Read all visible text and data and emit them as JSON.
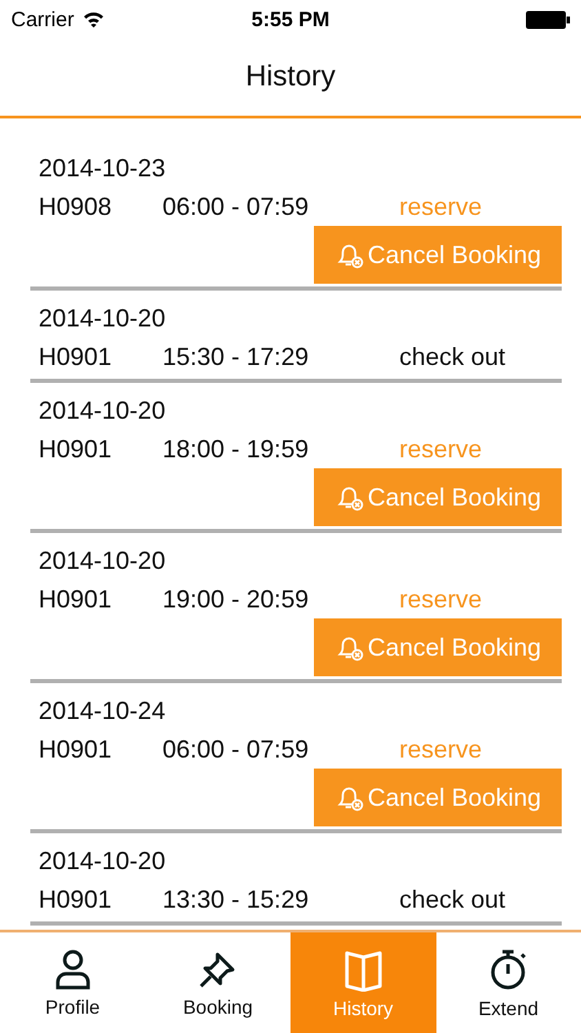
{
  "status_bar": {
    "carrier": "Carrier",
    "time": "5:55 PM"
  },
  "header": {
    "title": "History"
  },
  "bookings": [
    {
      "date": "2014-10-23",
      "room": "H0908",
      "time": "06:00 - 07:59",
      "status": "reserve",
      "kind": "reserve",
      "action": "Cancel Booking"
    },
    {
      "date": "2014-10-20",
      "room": "H0901",
      "time": "15:30 - 17:29",
      "status": "check out",
      "kind": "checkout"
    },
    {
      "date": "2014-10-20",
      "room": "H0901",
      "time": "18:00 - 19:59",
      "status": "reserve",
      "kind": "reserve",
      "action": "Cancel Booking"
    },
    {
      "date": "2014-10-20",
      "room": "H0901",
      "time": "19:00 - 20:59",
      "status": "reserve",
      "kind": "reserve",
      "action": "Cancel Booking"
    },
    {
      "date": "2014-10-24",
      "room": "H0901",
      "time": "06:00 - 07:59",
      "status": "reserve",
      "kind": "reserve",
      "action": "Cancel Booking"
    },
    {
      "date": "2014-10-20",
      "room": "H0901",
      "time": "13:30 - 15:29",
      "status": "check out",
      "kind": "checkout"
    }
  ],
  "tabs": [
    {
      "label": "Profile",
      "selected": false
    },
    {
      "label": "Booking",
      "selected": false
    },
    {
      "label": "History",
      "selected": true
    },
    {
      "label": "Extend",
      "selected": false
    }
  ]
}
